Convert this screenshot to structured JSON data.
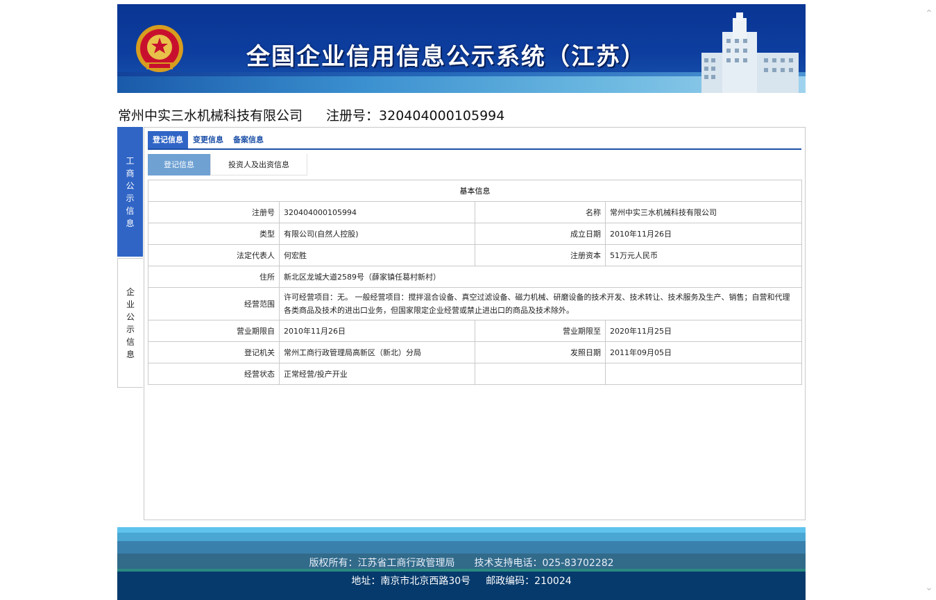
{
  "banner": {
    "title": "全国企业信用信息公示系统（江苏）"
  },
  "company": {
    "name": "常州中实三水机械科技有限公司",
    "reg_label": "注册号：",
    "reg_no": "320404000105994"
  },
  "side_tabs": [
    {
      "label": "工商公示信息",
      "active": true
    },
    {
      "label": "企业公示信息",
      "active": false
    }
  ],
  "top_tabs": [
    {
      "label": "登记信息",
      "active": true
    },
    {
      "label": "变更信息",
      "active": false
    },
    {
      "label": "备案信息",
      "active": false
    }
  ],
  "sub_tabs": [
    {
      "label": "登记信息",
      "active": true
    },
    {
      "label": "投资人及出资信息",
      "active": false
    }
  ],
  "basic_info": {
    "heading": "基本信息",
    "reg_no_label": "注册号",
    "reg_no": "320404000105994",
    "name_label": "名称",
    "name": "常州中实三水机械科技有限公司",
    "type_label": "类型",
    "type": "有限公司(自然人控股)",
    "found_label": "成立日期",
    "found": "2010年11月26日",
    "rep_label": "法定代表人",
    "rep": "何宏胜",
    "capital_label": "注册资本",
    "capital": "51万元人民币",
    "addr_label": "住所",
    "addr": "新北区龙城大道2589号（薛家镇任葛村新村）",
    "scope_label": "经营范围",
    "scope": "许可经营项目：无。 一般经营项目：搅拌混合设备、真空过滤设备、磁力机械、研磨设备的技术开发、技术转让、技术服务及生产、销售；自营和代理各类商品及技术的进出口业务，但国家限定企业经营或禁止进出口的商品及技术除外。",
    "from_label": "营业期限自",
    "from": "2010年11月26日",
    "to_label": "营业期限至",
    "to": "2020年11月25日",
    "authority_label": "登记机关",
    "authority": "常州工商行政管理局高新区（新北）分局",
    "issue_label": "发照日期",
    "issue": "2011年09月05日",
    "status_label": "经营状态",
    "status": "正常经营/投产开业"
  },
  "footer": {
    "copyright": "版权所有：江苏省工商行政管理局",
    "support": "技术支持电话：025-83702282",
    "address": "地址：南京市北京西路30号",
    "postcode": "邮政编码：210024"
  },
  "colors": {
    "accent": "#3065c6",
    "subtab_active": "#6fa1d3",
    "banner": "#0d3e9f",
    "footer": "#063a6c"
  }
}
